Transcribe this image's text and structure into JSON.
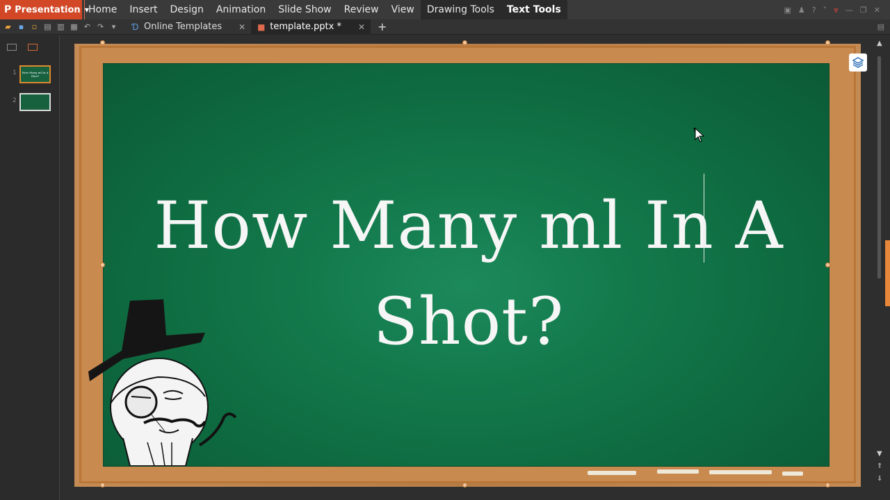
{
  "app": {
    "name": "Presentation",
    "logo_glyph": "P"
  },
  "menu": {
    "items": [
      "Home",
      "Insert",
      "Design",
      "Animation",
      "Slide Show",
      "Review",
      "View",
      "Drawing Tools",
      "Text Tools"
    ],
    "active": "Text Tools"
  },
  "tabs": [
    {
      "label": "Online Templates",
      "icon": "template-icon"
    },
    {
      "label": "template.pptx *",
      "icon": "pptx-file-icon"
    }
  ],
  "new_tab_glyph": "+",
  "slides": [
    {
      "number": "1",
      "thumb_text": "How Many ml In A Shot?"
    },
    {
      "number": "2",
      "thumb_text": ""
    }
  ],
  "slide": {
    "title_line1": "How Many ml In A",
    "title_line2": "Shot?"
  },
  "colors": {
    "accent": "#d24726",
    "board": "#137a4c",
    "frame": "#c98a4f"
  }
}
